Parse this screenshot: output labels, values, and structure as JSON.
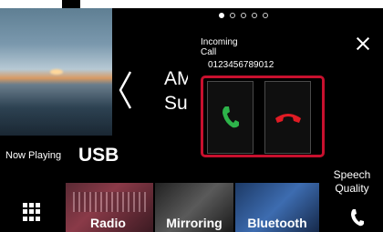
{
  "page_indicator": {
    "count": 5,
    "active": 1
  },
  "source_lines": [
    "AM",
    "Sur"
  ],
  "now_playing": {
    "label": "Now Playing",
    "source": "USB"
  },
  "incoming_call": {
    "title": "Incoming Call",
    "number": "0123456789012",
    "accept_icon": "phone-accept-icon",
    "reject_icon": "phone-reject-icon"
  },
  "speech_quality": "Speech Quality",
  "shortcuts": [
    {
      "label": "Radio"
    },
    {
      "label": "Mirroring"
    },
    {
      "label": "Bluetooth"
    }
  ],
  "colors": {
    "accept": "#2db34a",
    "reject": "#e01b24",
    "highlight": "#c8102e"
  }
}
